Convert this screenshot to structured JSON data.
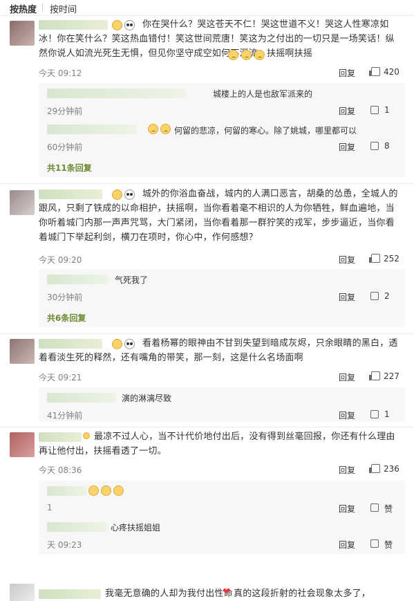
{
  "tabs": {
    "hot": "按热度",
    "time": "按时间"
  },
  "comments": [
    {
      "text": "你在哭什么？哭这苍天不仁！哭这世道不义！哭这人性寒凉如冰！你在笑什么？笑这热血错付！笑这世间荒唐！笑这为之付出的一切只是一场笑话！纵然你说人如流光死生无惧，但见你坚守成空如何不泪流，扶摇啊扶摇",
      "time": "今天 09:12",
      "reply": "回复",
      "likes": "420",
      "subs": [
        {
          "text": "城楼上的人是也敌军派来的",
          "time": "29分钟前",
          "reply": "回复",
          "likes": "1"
        },
        {
          "text": "何留的悲凉，何留的寒心。除了姚城，哪里都可以",
          "time": "60分钟前",
          "reply": "回复",
          "likes": "8"
        }
      ],
      "more": "共11条回复"
    },
    {
      "text": "城外的你浴血奋战，城内的人满口恶言，胡桑的怂恿，全城人的跟风，只剩了铁成的以命相护，扶摇啊，当你看着毫不相识的人为你牺牲，鲜血遍地，当你听着城门内那一声声咒骂，大门紧闭，当你看着那一群狞笑的戎军，步步逼近，当你看着城门下举起利剑，横刀在项时，你心中，作何感想？",
      "time": "今天 09:20",
      "reply": "回复",
      "likes": "252",
      "subs": [
        {
          "text": "气死我了",
          "time": "30分钟前",
          "reply": "回复",
          "likes": "2"
        }
      ],
      "more": "共6条回复"
    },
    {
      "text": "看着杨幂的眼神由不甘到失望到暗成灰烬，只余眼睛的黑白，透着看淡生死的释然，还有嘴角的带笑，那一刻，这是什么名场面啊",
      "time": "今天 09:21",
      "reply": "回复",
      "likes": "227",
      "subs": [
        {
          "text": "演的淋漓尽致",
          "time": "41分钟前",
          "reply": "回复",
          "likes": "1"
        }
      ]
    },
    {
      "text": "最凉不过人心，当不计代价地付出后，没有得到丝毫回报，你还有什么理由再让他付出，扶摇看透了一切。",
      "time": "今天 08:36",
      "reply": "回复",
      "likes": "236",
      "subs": [
        {
          "text": "",
          "time": "1",
          "reply": "回复",
          "likes": "赞"
        },
        {
          "text": "心疼扶摇姐姐",
          "time": "天 09:23",
          "reply": "回复",
          "likes": "赞"
        }
      ]
    },
    {
      "text": "我毫无意确的人却为我付出性命",
      "text2": "真的这段折射的社会现象太多了，"
    }
  ]
}
